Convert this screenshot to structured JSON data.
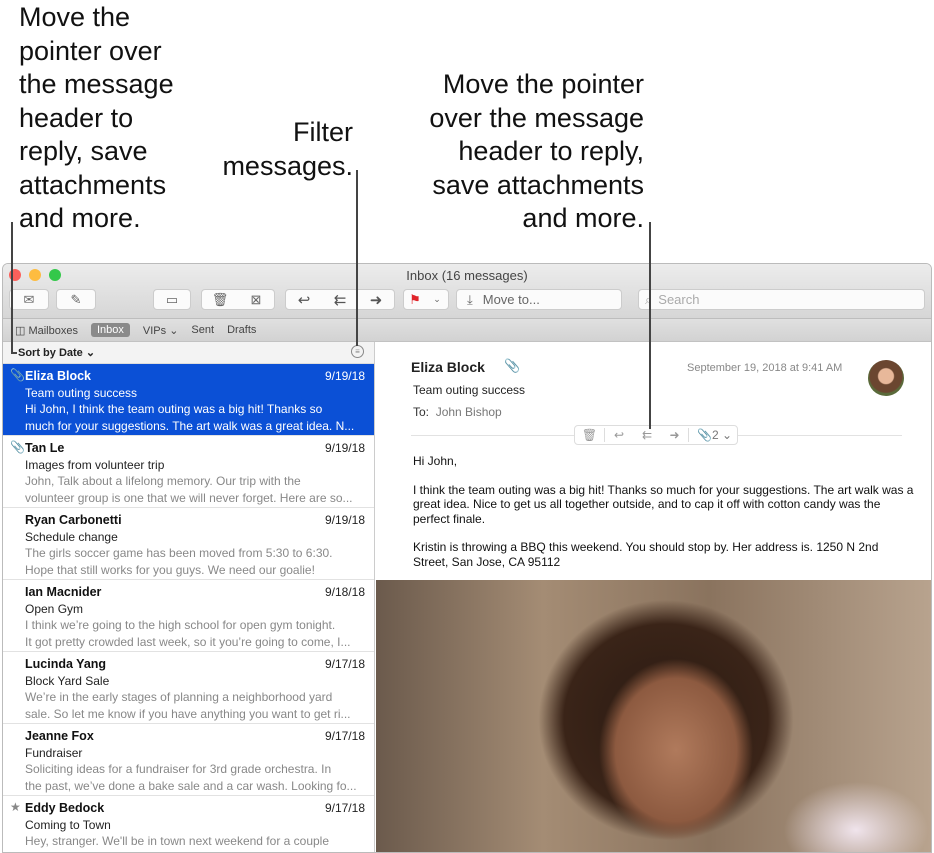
{
  "callouts": {
    "left": "Move the pointer over the message header to reply, save attachments and more.",
    "filter": "Filter messages.",
    "right": "Move the pointer over the message header to reply, save attachments and more."
  },
  "window": {
    "title": "Inbox (16 messages)"
  },
  "toolbar": {
    "move_to": "Move to...",
    "search_placeholder": "Search",
    "flag_color": "#e0242a"
  },
  "tabs": {
    "mailboxes": "Mailboxes",
    "inbox": "Inbox",
    "vips": "VIPs",
    "sent": "Sent",
    "drafts": "Drafts"
  },
  "sort": {
    "label": "Sort by Date"
  },
  "messages": [
    {
      "from": "Eliza Block",
      "date": "9/19/18",
      "subject": "Team outing success",
      "preview1": "Hi John, I think the team outing was a big hit! Thanks so",
      "preview2": "much for your suggestions. The art walk was a great idea. N..."
    },
    {
      "from": "Tan Le",
      "date": "9/19/18",
      "subject": "Images from volunteer trip",
      "preview1": "John, Talk about a lifelong memory. Our trip with the",
      "preview2": "volunteer group is one that we will never forget. Here are so..."
    },
    {
      "from": "Ryan Carbonetti",
      "date": "9/19/18",
      "subject": "Schedule change",
      "preview1": "The girls soccer game has been moved from 5:30 to 6:30.",
      "preview2": "Hope that still works for you guys. We need our goalie!"
    },
    {
      "from": "Ian Macnider",
      "date": "9/18/18",
      "subject": "Open Gym",
      "preview1": "I think we’re going to the high school for open gym tonight.",
      "preview2": "It got pretty crowded last week, so it you’re going to come, I..."
    },
    {
      "from": "Lucinda Yang",
      "date": "9/17/18",
      "subject": "Block Yard Sale",
      "preview1": "We’re in the early stages of planning a neighborhood yard",
      "preview2": "sale. So let me know if you have anything you want to get ri..."
    },
    {
      "from": "Jeanne Fox",
      "date": "9/17/18",
      "subject": "Fundraiser",
      "preview1": "Soliciting ideas for a fundraiser for 3rd grade orchestra. In",
      "preview2": "the past, we’ve done a bake sale and a car wash. Looking fo..."
    },
    {
      "from": "Eddy Bedock",
      "date": "9/17/18",
      "subject": "Coming to Town",
      "preview1": "Hey, stranger. We'll be in town next weekend for a couple",
      "preview2": ""
    }
  ],
  "message": {
    "from": "Eliza Block",
    "date": "September 19, 2018 at 9:41 AM",
    "subject": "Team outing success",
    "to_label": "To:",
    "to": "John Bishop",
    "attachments": "2",
    "body": [
      "Hi John,",
      "I think the team outing was a big hit! Thanks so much for your suggestions. The art walk was a great idea. Nice to get us all together outside, and to cap it off with cotton candy was the perfect finale.",
      "Kristin is throwing a BBQ this weekend. You should stop by. Her address is. 1250 N 2nd Street, San Jose, CA 95112"
    ]
  }
}
